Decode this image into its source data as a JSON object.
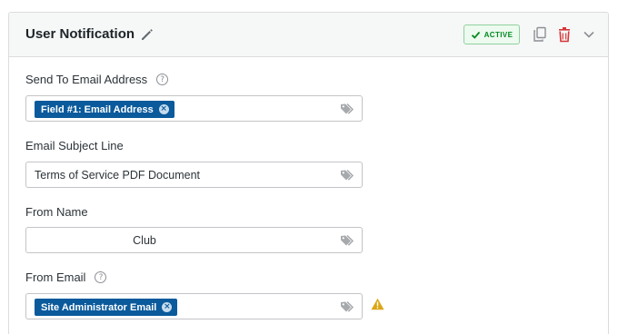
{
  "panel": {
    "title": "User Notification",
    "status_badge": "ACTIVE"
  },
  "fields": {
    "send_to": {
      "label": "Send To Email Address",
      "help": "?",
      "tag": "Field #1: Email Address",
      "tag_remove": "×"
    },
    "subject": {
      "label": "Email Subject Line",
      "value": "Terms of Service PDF Document"
    },
    "from_name": {
      "label": "From Name",
      "value": "Club"
    },
    "from_email": {
      "label": "From Email",
      "help": "?",
      "tag": "Site Administrator Email",
      "tag_remove": "×"
    }
  },
  "icons": {
    "edit": "pencil-icon",
    "copy": "copy-icon",
    "delete": "trash-icon",
    "collapse": "chevron-down-icon",
    "smart_tags": "tags-icon",
    "warning": "warning-icon"
  },
  "colors": {
    "tag_blue": "#0a5a9c",
    "active_green": "#008a20",
    "delete_red": "#d63638",
    "warning_yellow": "#dba617"
  }
}
